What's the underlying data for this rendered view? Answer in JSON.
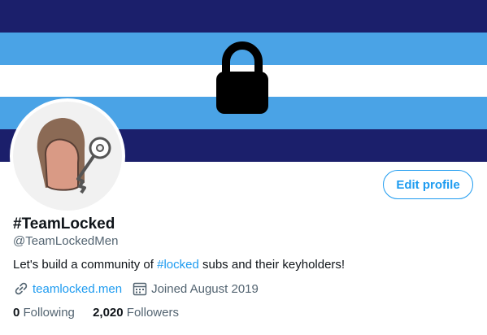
{
  "banner": {
    "stripes": [
      "#1b1f6b",
      "#4aa3e6",
      "#ffffff",
      "#4aa3e6",
      "#1b1f6b"
    ],
    "icon": "lock-icon"
  },
  "avatar": {
    "icon": "key-icon"
  },
  "profile": {
    "edit_label": "Edit profile",
    "display_name": "#TeamLocked",
    "handle": "@TeamLockedMen",
    "bio_before": "Let's build a community of ",
    "bio_hashtag": "#locked",
    "bio_after": " subs and their keyholders!",
    "website": "teamlocked.men",
    "joined": "Joined August 2019",
    "following_count": "0",
    "following_label": "Following",
    "followers_count": "2,020",
    "followers_label": "Followers"
  },
  "colors": {
    "accent": "#1d9bf0",
    "secondary_text": "#536471",
    "primary_text": "#0f1419"
  }
}
